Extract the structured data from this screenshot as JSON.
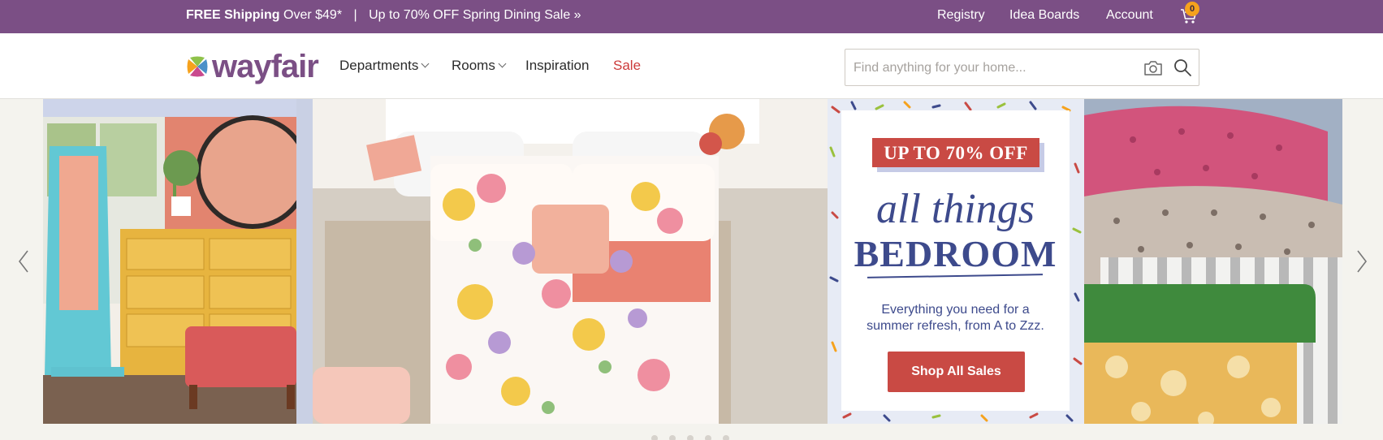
{
  "topbar": {
    "free_shipping": "FREE Shipping",
    "over_amount": "Over $49*",
    "separator": "|",
    "sale_promo": "Up to 70% OFF Spring Dining Sale »",
    "links": [
      "Registry",
      "Idea Boards",
      "Account"
    ],
    "cart_count": "0",
    "bg_color": "#7b4f85"
  },
  "header": {
    "logo_text": "wayfair",
    "nav": [
      "Departments",
      "Rooms",
      "Inspiration",
      "Sale"
    ],
    "search_placeholder": "Find anything for your home...",
    "search_value": ""
  },
  "hero": {
    "tag": "UP TO 70% OFF",
    "script": "all things",
    "headline": "BEDROOM",
    "description": "Everything you need for a summer refresh, from A to Zzz.",
    "cta": "Shop All Sales",
    "accent_color": "#c94a44",
    "text_color": "#3d4a8c"
  },
  "icons": [
    "cart-icon",
    "camera-icon",
    "search-icon",
    "chevron-left-icon",
    "chevron-right-icon"
  ]
}
